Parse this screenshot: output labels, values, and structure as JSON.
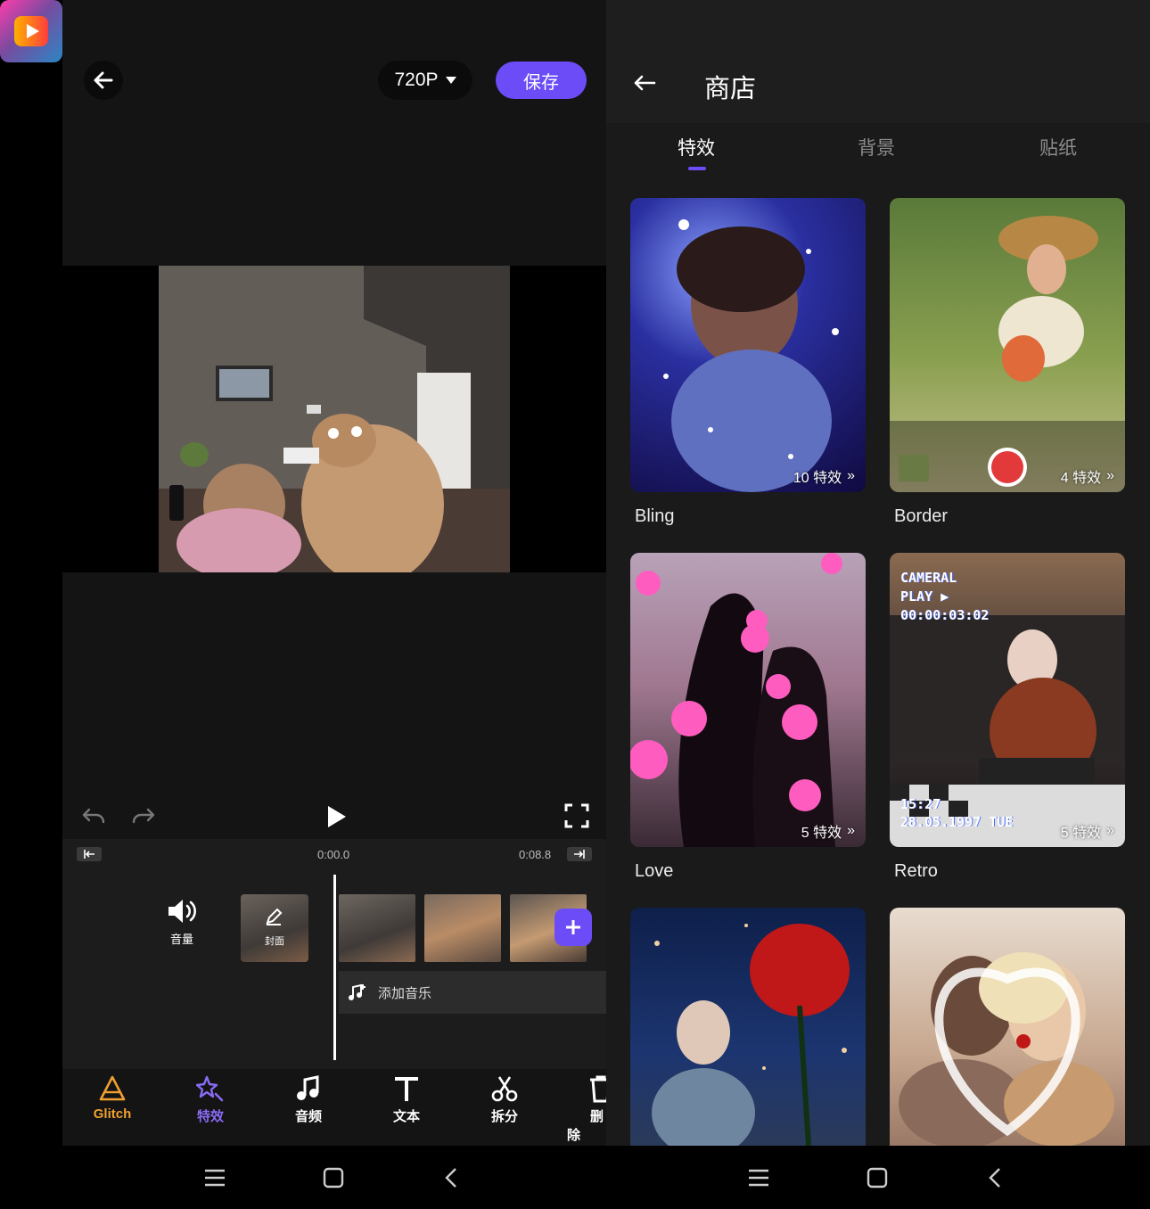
{
  "editor": {
    "resolution": "720P",
    "save_label": "保存",
    "time_start": "0:00.0",
    "time_end": "0:08.8",
    "volume_label": "音量",
    "cover_label": "封面",
    "add_music_label": "添加音乐",
    "tools": [
      {
        "label": "Glitch",
        "icon": "glitch-icon",
        "color": "#f0a030"
      },
      {
        "label": "特效",
        "icon": "sparkle-effects-icon",
        "color": "#8a6bf5"
      },
      {
        "label": "音频",
        "icon": "music-note-icon",
        "color": "#ffffff"
      },
      {
        "label": "文本",
        "icon": "text-icon",
        "color": "#ffffff"
      },
      {
        "label": "拆分",
        "icon": "scissors-icon",
        "color": "#ffffff"
      },
      {
        "label": "删除",
        "icon": "trash-icon",
        "color": "#ffffff"
      }
    ]
  },
  "store": {
    "title": "商店",
    "tabs": [
      "特效",
      "背景",
      "贴纸"
    ],
    "active_tab": 0,
    "cards": [
      {
        "title": "Bling",
        "badge": "10 特效"
      },
      {
        "title": "Border",
        "badge": "4 特效"
      },
      {
        "title": "Love",
        "badge": "5 特效"
      },
      {
        "title": "Retro",
        "badge": "5 特效",
        "overlay_top": "CAMERAL\nPLAY ▶\n00:00:03:02",
        "overlay_bottom": "15:27\n28.05.1997 TUE"
      },
      {
        "title": "",
        "badge": ""
      },
      {
        "title": "",
        "badge": ""
      }
    ]
  },
  "colors": {
    "accent": "#6b4cf6",
    "glitch": "#f0a030"
  }
}
